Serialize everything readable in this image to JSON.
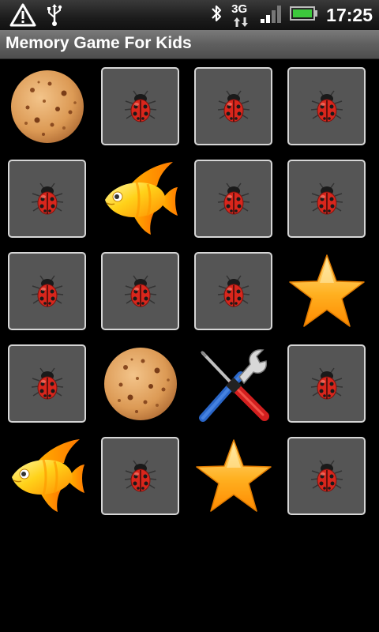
{
  "status_bar": {
    "time": "17:25",
    "network_label": "3G",
    "icons": [
      "alert-icon",
      "usb-icon",
      "bluetooth-icon",
      "network-3g-icon",
      "signal-icon",
      "battery-icon"
    ]
  },
  "app": {
    "title": "Memory Game For Kids"
  },
  "board": {
    "columns": 4,
    "rows": 5,
    "cards": [
      {
        "state": "revealed",
        "icon": "cookie-icon"
      },
      {
        "state": "hidden",
        "icon": "ladybug-icon"
      },
      {
        "state": "hidden",
        "icon": "ladybug-icon"
      },
      {
        "state": "hidden",
        "icon": "ladybug-icon"
      },
      {
        "state": "hidden",
        "icon": "ladybug-icon"
      },
      {
        "state": "revealed",
        "icon": "fish-icon"
      },
      {
        "state": "hidden",
        "icon": "ladybug-icon"
      },
      {
        "state": "hidden",
        "icon": "ladybug-icon"
      },
      {
        "state": "hidden",
        "icon": "ladybug-icon"
      },
      {
        "state": "hidden",
        "icon": "ladybug-icon"
      },
      {
        "state": "hidden",
        "icon": "ladybug-icon"
      },
      {
        "state": "revealed",
        "icon": "star-icon"
      },
      {
        "state": "hidden",
        "icon": "ladybug-icon"
      },
      {
        "state": "revealed",
        "icon": "cookie-icon"
      },
      {
        "state": "revealed",
        "icon": "tools-icon"
      },
      {
        "state": "hidden",
        "icon": "ladybug-icon"
      },
      {
        "state": "revealed",
        "icon": "fish-icon"
      },
      {
        "state": "hidden",
        "icon": "ladybug-icon"
      },
      {
        "state": "revealed",
        "icon": "star-icon"
      },
      {
        "state": "hidden",
        "icon": "ladybug-icon"
      }
    ]
  }
}
